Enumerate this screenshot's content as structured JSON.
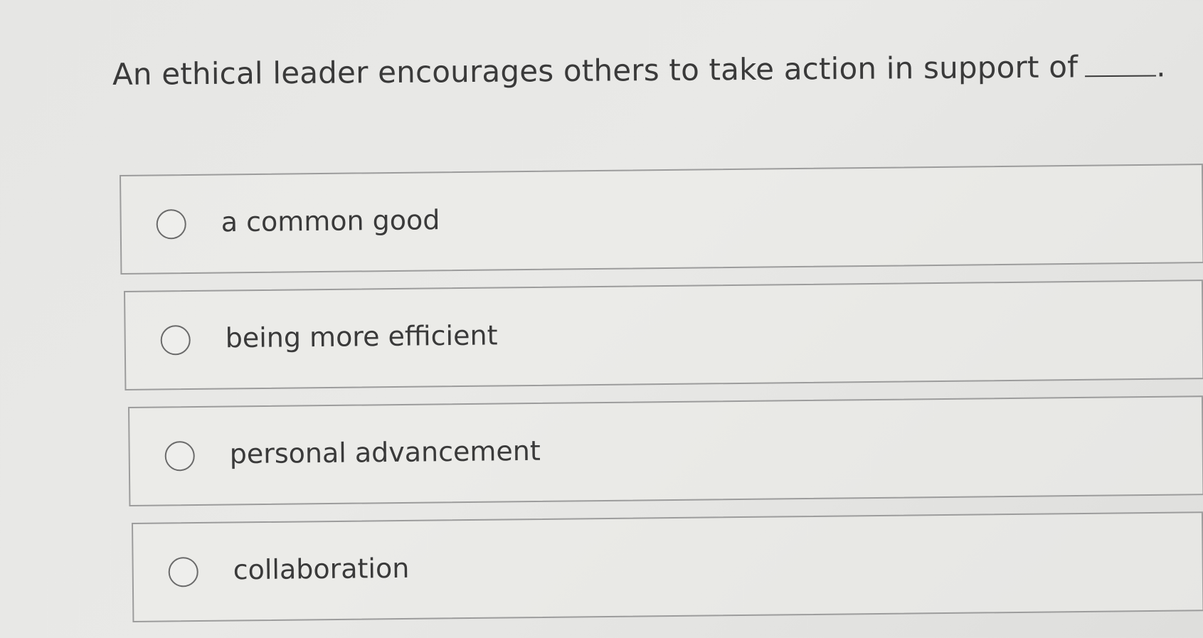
{
  "question": {
    "text": "An ethical leader encourages others to take action in support of",
    "end_punct": "."
  },
  "options": [
    {
      "label": "a common good"
    },
    {
      "label": "being more efficient"
    },
    {
      "label": "personal advancement"
    },
    {
      "label": "collaboration"
    }
  ]
}
